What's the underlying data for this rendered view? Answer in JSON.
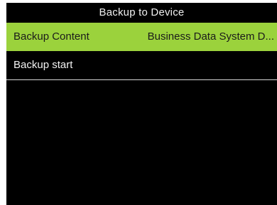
{
  "header": {
    "title": "Backup to Device"
  },
  "menu": {
    "items": [
      {
        "label": "Backup Content",
        "value": "Business Data System D..."
      },
      {
        "label": "Backup start"
      }
    ]
  }
}
